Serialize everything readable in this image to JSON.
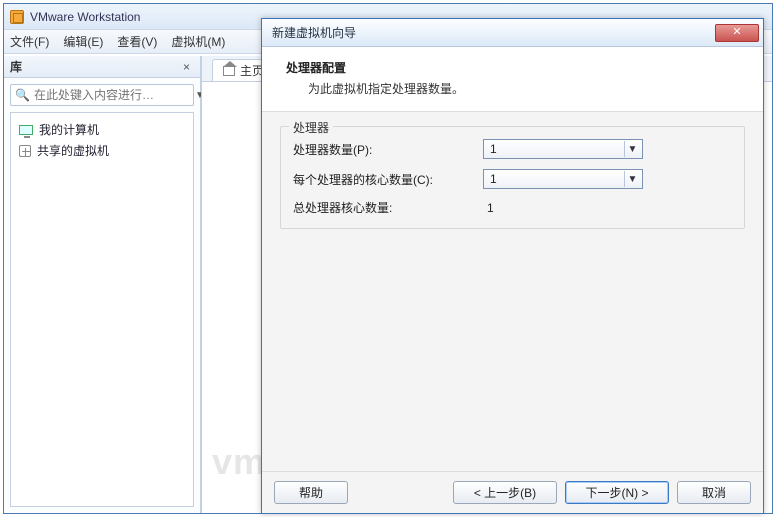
{
  "main": {
    "title": "VMware Workstation",
    "menu": {
      "file": "文件(F)",
      "edit": "编辑(E)",
      "view": "查看(V)",
      "vm": "虚拟机(M)"
    },
    "sidebar": {
      "title": "库",
      "search_placeholder": "在此处键入内容进行…",
      "items": [
        {
          "label": "我的计算机"
        },
        {
          "label": "共享的虚拟机"
        }
      ]
    },
    "tab_home": "主页",
    "watermark": "vm"
  },
  "dialog": {
    "title": "新建虚拟机向导",
    "header_title": "处理器配置",
    "header_sub": "为此虚拟机指定处理器数量。",
    "group_legend": "处理器",
    "rows": {
      "proc_count_label": "处理器数量(P):",
      "proc_count_value": "1",
      "cores_label": "每个处理器的核心数量(C):",
      "cores_value": "1",
      "total_label": "总处理器核心数量:",
      "total_value": "1"
    },
    "buttons": {
      "help": "帮助",
      "back": "< 上一步(B)",
      "next": "下一步(N) >",
      "cancel": "取消"
    }
  }
}
